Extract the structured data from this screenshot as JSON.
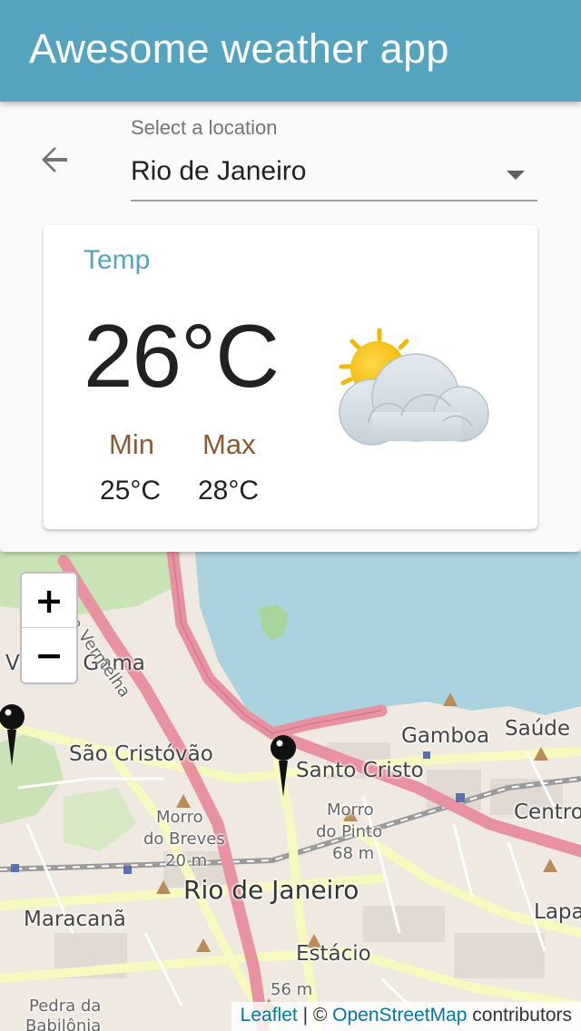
{
  "app": {
    "title": "Awesome weather app"
  },
  "location_select": {
    "label": "Select a location",
    "value": "Rio de Janeiro"
  },
  "weather_card": {
    "title": "Temp",
    "current_temp": "26°C",
    "min_label": "Min",
    "min_value": "25°C",
    "max_label": "Max",
    "max_value": "28°C",
    "condition_icon": "partly-cloudy-icon"
  },
  "map": {
    "zoom_in": "+",
    "zoom_out": "−",
    "labels": {
      "vila_da_gama": "Vila da Gama",
      "sao_cristovao": "São Cristóvão",
      "santo_cristo": "Santo Cristo",
      "gamboa": "Gamboa",
      "saude": "Saúde",
      "centro": "Centro",
      "morro_breves_1": "Morro",
      "morro_breves_2": "do Breves",
      "breves_elev": "20 m",
      "morro_pinto_1": "Morro",
      "morro_pinto_2": "do Pinto",
      "pinto_elev": "68 m",
      "rio": "Rio de Janeiro",
      "maracana": "Maracanã",
      "estacio": "Estácio",
      "lapa": "Lapa",
      "elev_56": "56 m",
      "pedra_1": "Pedra da",
      "pedra_2": "Babilônia",
      "rua_vermelha": "Rua Vermelha"
    },
    "attribution": {
      "leaflet": "Leaflet",
      "sep": " | © ",
      "osm": "OpenStreetMap",
      "contributors": " contributors"
    }
  },
  "colors": {
    "appbar": "#54a4c0",
    "accent_text": "#54a4c0",
    "minmax_label": "#8a5a34",
    "water": "#aad3df",
    "road_primary": "#e891a1",
    "road_secondary": "#f7fabf"
  }
}
